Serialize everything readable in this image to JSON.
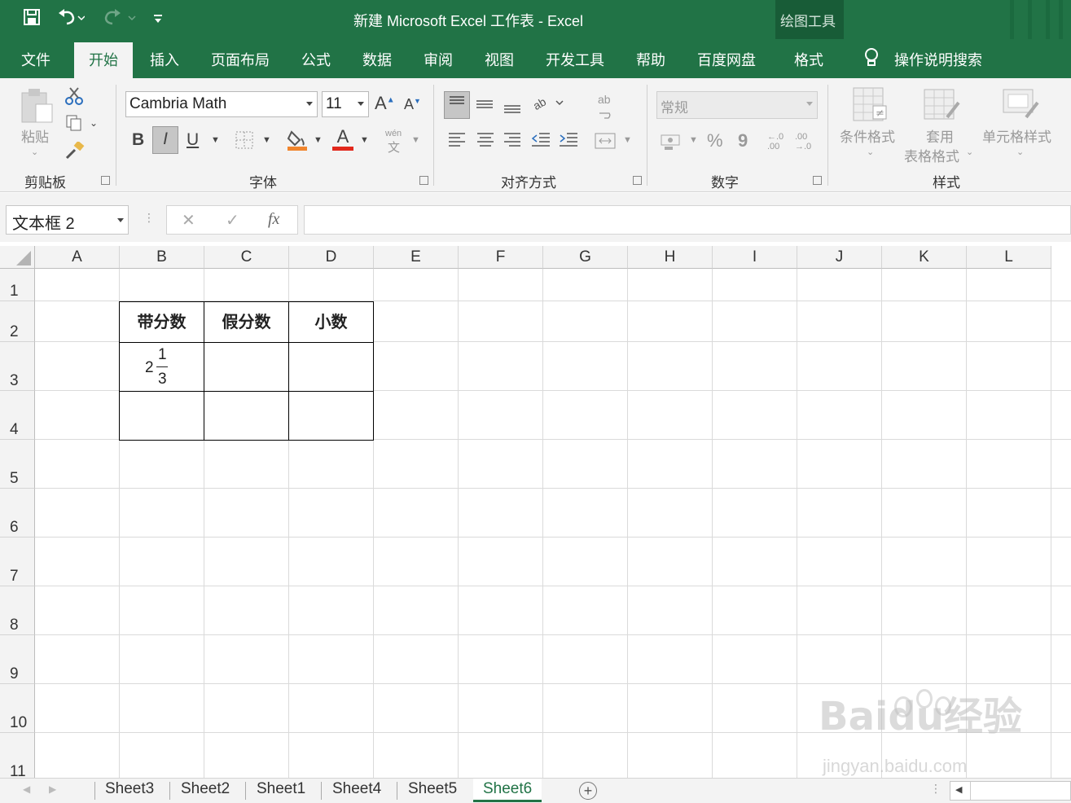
{
  "window": {
    "title": "新建 Microsoft Excel 工作表  -  Excel",
    "context_title": "绘图工具"
  },
  "tabs": [
    "文件",
    "开始",
    "插入",
    "页面布局",
    "公式",
    "数据",
    "审阅",
    "视图",
    "开发工具",
    "帮助",
    "百度网盘",
    "格式"
  ],
  "active_tab": "开始",
  "tell_me": "操作说明搜索",
  "ribbon": {
    "clipboard": {
      "paste": "粘贴",
      "label": "剪贴板"
    },
    "font": {
      "name": "Cambria Math",
      "size": "11",
      "bold": "B",
      "italic": "I",
      "underline": "U",
      "grow": "A",
      "shrink": "A",
      "font_color": "A",
      "phonetic": "wén",
      "phonetic_char": "文",
      "label": "字体"
    },
    "alignment": {
      "label": "对齐方式",
      "wrap": "ab"
    },
    "number": {
      "format": "常规",
      "percent": "%",
      "comma": "9",
      "inc_decimal": "←.0 .00",
      "dec_decimal": ".00 →.0",
      "label": "数字"
    },
    "styles": {
      "conditional": "条件格式",
      "table_line1": "套用",
      "table_line2": "表格格式",
      "cell_styles": "单元格样式",
      "label": "样式"
    }
  },
  "formula_bar": {
    "name_box": "文本框 2",
    "cancel": "✕",
    "enter": "✓",
    "fx": "fx",
    "value": ""
  },
  "columns": [
    "A",
    "B",
    "C",
    "D",
    "E",
    "F",
    "G",
    "H",
    "I",
    "J",
    "K",
    "L"
  ],
  "rows": [
    "1",
    "2",
    "3",
    "4",
    "5",
    "6",
    "7",
    "8",
    "9",
    "10",
    "11"
  ],
  "table": {
    "headers": [
      "带分数",
      "假分数",
      "小数"
    ],
    "mixed_number": {
      "whole": "2",
      "numerator": "1",
      "denominator": "3"
    }
  },
  "sheets": [
    "Sheet3",
    "Sheet2",
    "Sheet1",
    "Sheet4",
    "Sheet5",
    "Sheet6"
  ],
  "active_sheet": "Sheet6",
  "watermark": {
    "text": "Baidu经验",
    "url": "jingyan.baidu.com"
  },
  "colors": {
    "excel_green": "#217346",
    "dark_green": "#185c37",
    "fill_orange": "#f0852d",
    "font_red": "#e2281c"
  }
}
